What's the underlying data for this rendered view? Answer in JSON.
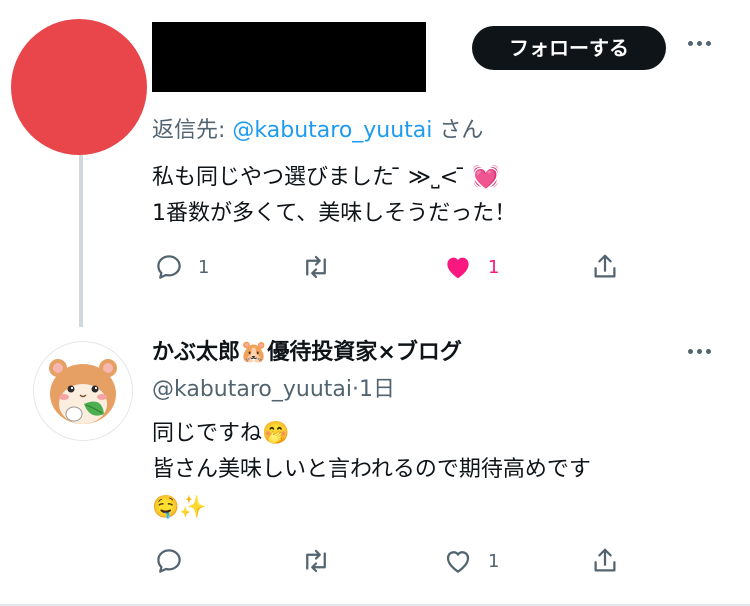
{
  "tweet1": {
    "follow_label": "フォローする",
    "reply_prefix": "返信先: ",
    "reply_mention": "@kabutaro_yuutai",
    "reply_suffix": " さん",
    "text_line1": "私も同じやつ選びました ̄ ≫˽< ̄ 💓",
    "text_line2": "1番数が多くて、美味しそうだった！",
    "reply_count": "1",
    "like_count": "1"
  },
  "tweet2": {
    "name": "かぶ太郎🐹優待投資家×ブログ",
    "handle": "@kabutaro_yuutai",
    "separator": "·",
    "time": "1日",
    "text_line1": "同じですね🤭",
    "text_line2": "皆さん美味しいと言われるので期待高めです",
    "text_line3": "🤤✨",
    "like_count": "1"
  },
  "colors": {
    "accent_blue": "#1d9bf0",
    "like_pink": "#f91880",
    "muted": "#536471",
    "avatar_red": "#e8464a"
  }
}
